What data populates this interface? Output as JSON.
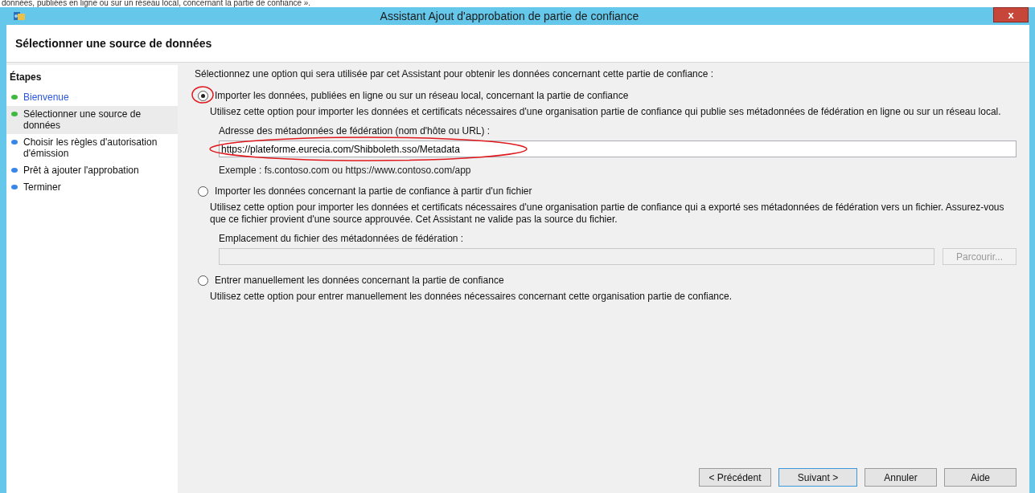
{
  "caption": "données, publiées en ligne ou sur un réseau local, concernant la partie de confiance ».",
  "window": {
    "title": "Assistant Ajout d'approbation de partie de confiance",
    "close": "x"
  },
  "header": {
    "title": "Sélectionner une source de données"
  },
  "steps": {
    "title": "Étapes",
    "items": [
      {
        "label": "Bienvenue",
        "color": "#3fb83f",
        "visited": true,
        "selected": false
      },
      {
        "label": "Sélectionner une source de données",
        "color": "#3fb83f",
        "visited": false,
        "selected": true
      },
      {
        "label": "Choisir les règles d'autorisation d'émission",
        "color": "#3a86e8",
        "visited": false,
        "selected": false
      },
      {
        "label": "Prêt à ajouter l'approbation",
        "color": "#3a86e8",
        "visited": false,
        "selected": false
      },
      {
        "label": "Terminer",
        "color": "#3a86e8",
        "visited": false,
        "selected": false
      }
    ]
  },
  "intro": "Sélectionnez une option qui sera utilisée par cet Assistant pour obtenir les données concernant cette partie de confiance :",
  "options": [
    {
      "label": "Importer les données, publiées en ligne ou sur un réseau local, concernant la partie de confiance",
      "selected": true,
      "description": "Utilisez cette option pour importer les données et certificats nécessaires d'une organisation partie de confiance qui publie ses métadonnées de fédération en ligne ou sur un réseau local.",
      "field": {
        "label": "Adresse des métadonnées de fédération (nom d'hôte ou URL) :",
        "value": "https://plateforme.eurecia.com/Shibboleth.sso/Metadata",
        "disabled": false,
        "hint": "Exemple : fs.contoso.com ou https://www.contoso.com/app"
      }
    },
    {
      "label": "Importer les données concernant la partie de confiance à partir d'un fichier",
      "selected": false,
      "description": "Utilisez cette option pour importer les données et certificats nécessaires d'une organisation partie de confiance qui a exporté ses métadonnées de fédération vers un fichier. Assurez-vous que ce fichier provient d'une source approuvée. Cet Assistant ne valide pas la source du fichier.",
      "field": {
        "label": "Emplacement du fichier des métadonnées de fédération :",
        "disabled": true,
        "browse": "Parcourir..."
      }
    },
    {
      "label": "Entrer manuellement les données concernant la partie de confiance",
      "selected": false,
      "description": "Utilisez cette option pour entrer manuellement les données nécessaires concernant cette organisation partie de confiance."
    }
  ],
  "buttons": [
    {
      "label": "< Précédent",
      "default": false
    },
    {
      "label": "Suivant >",
      "default": true
    },
    {
      "label": "Annuler",
      "default": false
    },
    {
      "label": "Aide",
      "default": false
    }
  ]
}
